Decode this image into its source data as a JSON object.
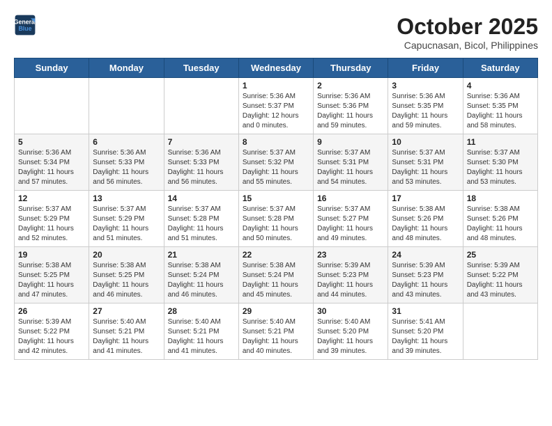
{
  "header": {
    "logo_line1": "General",
    "logo_line2": "Blue",
    "month": "October 2025",
    "location": "Capucnasan, Bicol, Philippines"
  },
  "days_of_week": [
    "Sunday",
    "Monday",
    "Tuesday",
    "Wednesday",
    "Thursday",
    "Friday",
    "Saturday"
  ],
  "weeks": [
    {
      "days": [
        {
          "date": "",
          "info": ""
        },
        {
          "date": "",
          "info": ""
        },
        {
          "date": "",
          "info": ""
        },
        {
          "date": "1",
          "info": "Sunrise: 5:36 AM\nSunset: 5:37 PM\nDaylight: 12 hours\nand 0 minutes."
        },
        {
          "date": "2",
          "info": "Sunrise: 5:36 AM\nSunset: 5:36 PM\nDaylight: 11 hours\nand 59 minutes."
        },
        {
          "date": "3",
          "info": "Sunrise: 5:36 AM\nSunset: 5:35 PM\nDaylight: 11 hours\nand 59 minutes."
        },
        {
          "date": "4",
          "info": "Sunrise: 5:36 AM\nSunset: 5:35 PM\nDaylight: 11 hours\nand 58 minutes."
        }
      ]
    },
    {
      "days": [
        {
          "date": "5",
          "info": "Sunrise: 5:36 AM\nSunset: 5:34 PM\nDaylight: 11 hours\nand 57 minutes."
        },
        {
          "date": "6",
          "info": "Sunrise: 5:36 AM\nSunset: 5:33 PM\nDaylight: 11 hours\nand 56 minutes."
        },
        {
          "date": "7",
          "info": "Sunrise: 5:36 AM\nSunset: 5:33 PM\nDaylight: 11 hours\nand 56 minutes."
        },
        {
          "date": "8",
          "info": "Sunrise: 5:37 AM\nSunset: 5:32 PM\nDaylight: 11 hours\nand 55 minutes."
        },
        {
          "date": "9",
          "info": "Sunrise: 5:37 AM\nSunset: 5:31 PM\nDaylight: 11 hours\nand 54 minutes."
        },
        {
          "date": "10",
          "info": "Sunrise: 5:37 AM\nSunset: 5:31 PM\nDaylight: 11 hours\nand 53 minutes."
        },
        {
          "date": "11",
          "info": "Sunrise: 5:37 AM\nSunset: 5:30 PM\nDaylight: 11 hours\nand 53 minutes."
        }
      ]
    },
    {
      "days": [
        {
          "date": "12",
          "info": "Sunrise: 5:37 AM\nSunset: 5:29 PM\nDaylight: 11 hours\nand 52 minutes."
        },
        {
          "date": "13",
          "info": "Sunrise: 5:37 AM\nSunset: 5:29 PM\nDaylight: 11 hours\nand 51 minutes."
        },
        {
          "date": "14",
          "info": "Sunrise: 5:37 AM\nSunset: 5:28 PM\nDaylight: 11 hours\nand 51 minutes."
        },
        {
          "date": "15",
          "info": "Sunrise: 5:37 AM\nSunset: 5:28 PM\nDaylight: 11 hours\nand 50 minutes."
        },
        {
          "date": "16",
          "info": "Sunrise: 5:37 AM\nSunset: 5:27 PM\nDaylight: 11 hours\nand 49 minutes."
        },
        {
          "date": "17",
          "info": "Sunrise: 5:38 AM\nSunset: 5:26 PM\nDaylight: 11 hours\nand 48 minutes."
        },
        {
          "date": "18",
          "info": "Sunrise: 5:38 AM\nSunset: 5:26 PM\nDaylight: 11 hours\nand 48 minutes."
        }
      ]
    },
    {
      "days": [
        {
          "date": "19",
          "info": "Sunrise: 5:38 AM\nSunset: 5:25 PM\nDaylight: 11 hours\nand 47 minutes."
        },
        {
          "date": "20",
          "info": "Sunrise: 5:38 AM\nSunset: 5:25 PM\nDaylight: 11 hours\nand 46 minutes."
        },
        {
          "date": "21",
          "info": "Sunrise: 5:38 AM\nSunset: 5:24 PM\nDaylight: 11 hours\nand 46 minutes."
        },
        {
          "date": "22",
          "info": "Sunrise: 5:38 AM\nSunset: 5:24 PM\nDaylight: 11 hours\nand 45 minutes."
        },
        {
          "date": "23",
          "info": "Sunrise: 5:39 AM\nSunset: 5:23 PM\nDaylight: 11 hours\nand 44 minutes."
        },
        {
          "date": "24",
          "info": "Sunrise: 5:39 AM\nSunset: 5:23 PM\nDaylight: 11 hours\nand 43 minutes."
        },
        {
          "date": "25",
          "info": "Sunrise: 5:39 AM\nSunset: 5:22 PM\nDaylight: 11 hours\nand 43 minutes."
        }
      ]
    },
    {
      "days": [
        {
          "date": "26",
          "info": "Sunrise: 5:39 AM\nSunset: 5:22 PM\nDaylight: 11 hours\nand 42 minutes."
        },
        {
          "date": "27",
          "info": "Sunrise: 5:40 AM\nSunset: 5:21 PM\nDaylight: 11 hours\nand 41 minutes."
        },
        {
          "date": "28",
          "info": "Sunrise: 5:40 AM\nSunset: 5:21 PM\nDaylight: 11 hours\nand 41 minutes."
        },
        {
          "date": "29",
          "info": "Sunrise: 5:40 AM\nSunset: 5:21 PM\nDaylight: 11 hours\nand 40 minutes."
        },
        {
          "date": "30",
          "info": "Sunrise: 5:40 AM\nSunset: 5:20 PM\nDaylight: 11 hours\nand 39 minutes."
        },
        {
          "date": "31",
          "info": "Sunrise: 5:41 AM\nSunset: 5:20 PM\nDaylight: 11 hours\nand 39 minutes."
        },
        {
          "date": "",
          "info": ""
        }
      ]
    }
  ]
}
